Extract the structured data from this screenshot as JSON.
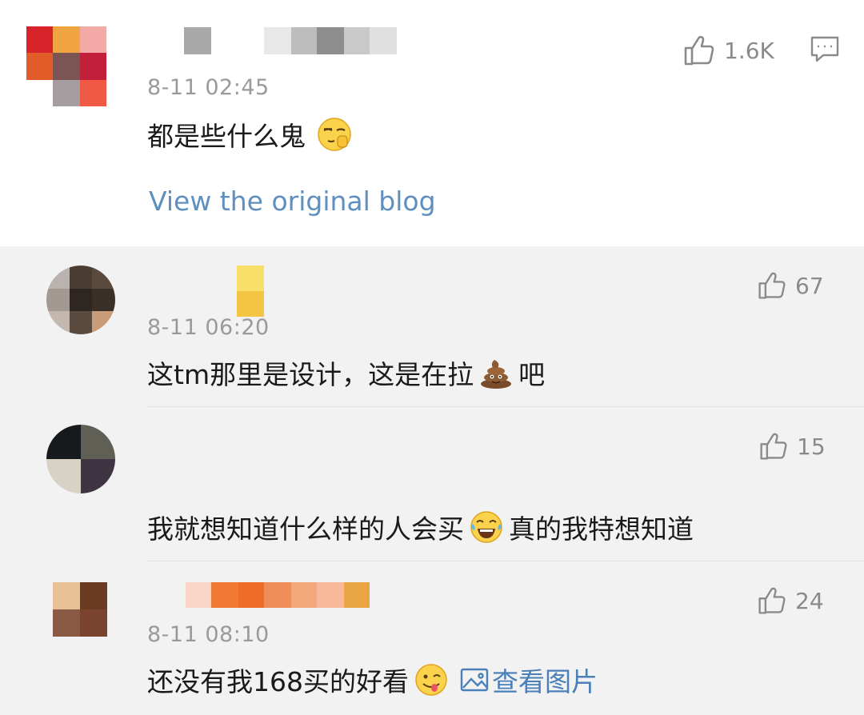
{
  "main": {
    "time": "8-11 02:45",
    "text": "都是些什么鬼",
    "likes": "1.6K",
    "view_blog": "View the original blog",
    "icons": {
      "like": "thumb-up-icon",
      "comment": "comment-icon",
      "emoji": "hand-over-mouth-emoji"
    }
  },
  "replies": [
    {
      "time": "8-11 06:20",
      "text_before": "这tm那里是设计，这是在拉",
      "emoji": "poop-emoji",
      "text_after": "吧",
      "likes": "67"
    },
    {
      "time": "",
      "text_before": "我就想知道什么样的人会买",
      "emoji": "tears-of-joy-emoji",
      "text_after": "真的我特想知道",
      "likes": "15"
    },
    {
      "time": "8-11 08:10",
      "text_before": "还没有我168买的好看",
      "emoji": "yum-emoji",
      "link_icon": "image-icon",
      "link_text": "查看图片",
      "likes": "24"
    }
  ],
  "colors": {
    "link": "#4a7fb8",
    "background": "#f2f2f2",
    "card": "#ffffff",
    "meta": "#9a9a9a"
  }
}
